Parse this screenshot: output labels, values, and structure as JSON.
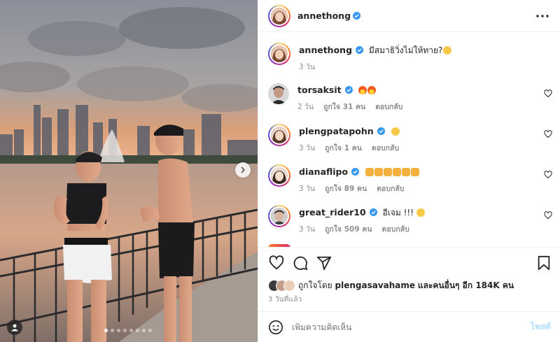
{
  "post": {
    "author": "annethong",
    "caption_text": "มีสมาธิวิ่งไม่ให้ทาย?",
    "caption_time": "3 วัน",
    "posted_ago": "3 วันที่แล้ว"
  },
  "comments": [
    {
      "user": "torsaksit",
      "text": "",
      "time": "2 วัน",
      "likes": "ถูกใจ 31 คน",
      "reply": "ตอบกลับ",
      "emoji": [
        "fire-icon",
        "fire-icon"
      ]
    },
    {
      "user": "plengpatapohn",
      "text": "",
      "time": "3 วัน",
      "likes": "ถูกใจ 1 คน",
      "reply": "ตอบกลับ",
      "emoji": [
        "laughing-face-icon"
      ]
    },
    {
      "user": "dianaflipo",
      "text": "",
      "time": "3 วัน",
      "likes": "ถูกใจ 89 คน",
      "reply": "ตอบกลับ",
      "emoji": [
        "clapping-hands-icon",
        "clapping-hands-icon",
        "clapping-hands-icon",
        "clapping-hands-icon",
        "clapping-hands-icon",
        "clapping-hands-icon"
      ]
    },
    {
      "user": "great_rider10",
      "text": "อีเจม !!!",
      "time": "3 วัน",
      "likes": "ถูกใจ 509 คน",
      "reply": "ตอบกลับ",
      "emoji": [
        "smiling-face-icon"
      ]
    }
  ],
  "likes": {
    "prefix": "ถูกใจโดย",
    "user": "plengasavahame",
    "suffix": "และคนอื่นๆ อีก 184K คน"
  },
  "add_comment": {
    "placeholder": "เพิ่มความคิดเห็น",
    "post_label": "โพสต์"
  },
  "carousel": {
    "total": 8,
    "active": 0
  },
  "colors": {
    "accent": "#0095f6",
    "verified": "#3897f0",
    "muted": "#8e8e8e",
    "post_disabled": "#b2dffc"
  }
}
